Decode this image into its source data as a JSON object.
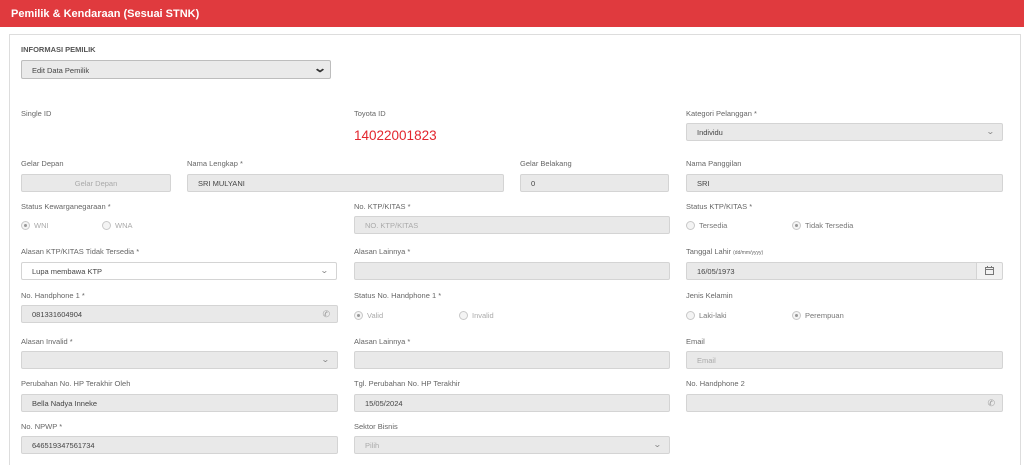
{
  "header": {
    "title": "Pemilik & Kendaraan (Sesuai STNK)"
  },
  "owner_info": {
    "title": "INFORMASI PEMILIK",
    "action_select": "Edit Data Pemilik"
  },
  "fields": {
    "single_id": {
      "label": "Single ID"
    },
    "toyota_id": {
      "label": "Toyota ID",
      "value": "14022001823"
    },
    "kategori": {
      "label": "Kategori Pelanggan *",
      "value": "Individu"
    },
    "gelar_depan": {
      "label": "Gelar Depan",
      "placeholder": "Gelar Depan"
    },
    "nama_lengkap": {
      "label": "Nama Lengkap *",
      "value": "SRI MULYANI"
    },
    "gelar_belakang": {
      "label": "Gelar Belakang",
      "value": "0"
    },
    "nama_panggilan": {
      "label": "Nama Panggilan",
      "value": "SRI"
    },
    "kewarganegaraan": {
      "label": "Status Kewarganegaraan *",
      "options": [
        "WNI",
        "WNA"
      ],
      "selected": "WNI"
    },
    "ktp": {
      "label": "No. KTP/KITAS *",
      "placeholder": "NO. KTP/KITAS"
    },
    "status_ktp": {
      "label": "Status KTP/KITAS *",
      "options": [
        "Tersedia",
        "Tidak Tersedia"
      ],
      "selected": "Tidak Tersedia"
    },
    "alasan_ktp": {
      "label": "Alasan KTP/KITAS Tidak Tersedia *",
      "value": "Lupa membawa KTP"
    },
    "alasan_lainnya_1": {
      "label": "Alasan Lainnya *"
    },
    "tanggal_lahir": {
      "label": "Tanggal Lahir",
      "label_hint": "(dd/mm/yyyy)",
      "value": "16/05/1973"
    },
    "hp1": {
      "label": "No. Handphone 1 *",
      "value": "081331604904"
    },
    "status_hp1": {
      "label": "Status No. Handphone 1 *",
      "options": [
        "Valid",
        "Invalid"
      ],
      "selected": "Valid"
    },
    "jenis_kelamin": {
      "label": "Jenis Kelamin",
      "options": [
        "Laki-laki",
        "Perempuan"
      ],
      "selected": "Perempuan"
    },
    "alasan_invalid": {
      "label": "Alasan Invalid *",
      "value": ""
    },
    "alasan_lainnya_2": {
      "label": "Alasan Lainnya *"
    },
    "email": {
      "label": "Email",
      "placeholder": "Email"
    },
    "perubahan_hp_oleh": {
      "label": "Perubahan No. HP Terakhir Oleh",
      "value": "Bella Nadya Inneke"
    },
    "tgl_perubahan_hp": {
      "label": "Tgl. Perubahan No. HP Terakhir",
      "value": "15/05/2024"
    },
    "hp2": {
      "label": "No. Handphone 2",
      "value": ""
    },
    "npwp": {
      "label": "No. NPWP *",
      "value": "646519347561734"
    },
    "sektor_bisnis": {
      "label": "Sektor Bisnis",
      "placeholder": "Pilih"
    }
  },
  "icons": {
    "chevron": "chevron-down-icon",
    "phone": "phone-icon",
    "calendar": "calendar-icon"
  },
  "colors": {
    "header_bg": "#e03a3e",
    "toyota_id": "#e3262e"
  }
}
